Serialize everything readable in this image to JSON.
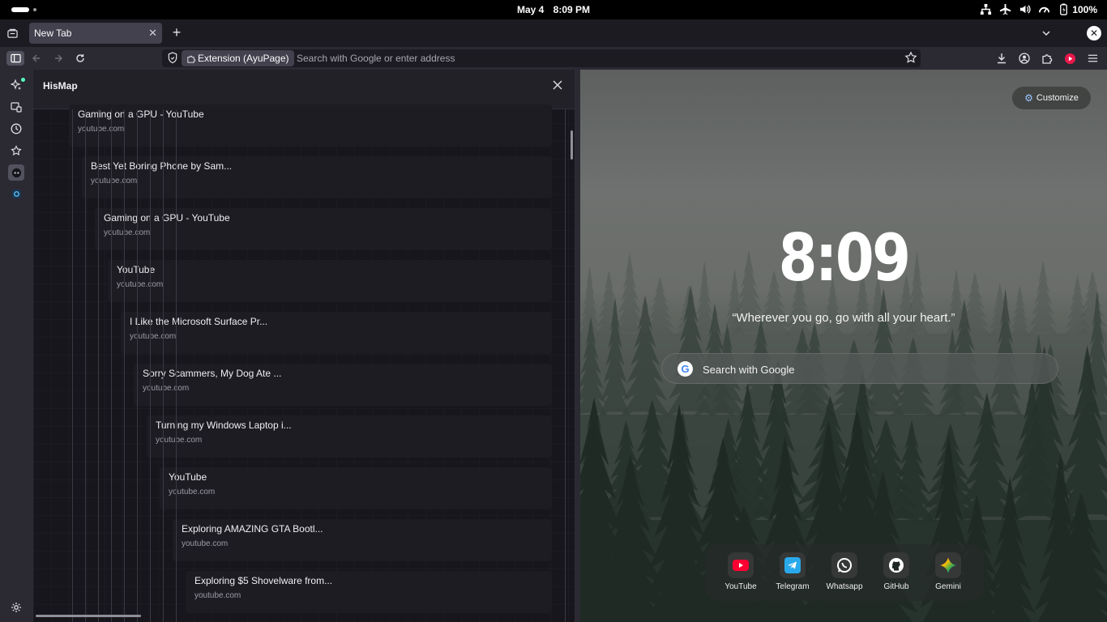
{
  "system_bar": {
    "date": "May 4",
    "time": "8:09 PM",
    "battery": "100%",
    "tray_icons": [
      "network-icon",
      "airplane-icon",
      "volume-icon",
      "performance-icon",
      "battery-icon"
    ]
  },
  "browser": {
    "tabs": [
      {
        "title": "New Tab",
        "active": true
      }
    ],
    "urlbar": {
      "extension_chip": "Extension (AyuPage)",
      "placeholder": "Search with Google or enter address"
    },
    "accent_color": "#2b2a33"
  },
  "sidebar_panel": {
    "title": "HisMap",
    "nodes": [
      {
        "title": "Gaming on a GPU - YouTube",
        "domain": "youtube.com"
      },
      {
        "title": "Best Yet Boring Phone by Sam...",
        "domain": "youtube.com"
      },
      {
        "title": "Gaming on a GPU - YouTube",
        "domain": "youtube.com"
      },
      {
        "title": "YouTube",
        "domain": "youtube.com"
      },
      {
        "title": "I Like the Microsoft Surface Pr...",
        "domain": "youtube.com"
      },
      {
        "title": "Sorry Scammers, My Dog Ate ...",
        "domain": "youtube.com"
      },
      {
        "title": "Turning my Windows Laptop i...",
        "domain": "youtube.com"
      },
      {
        "title": "YouTube",
        "domain": "youtube.com"
      },
      {
        "title": "Exploring AMAZING GTA Bootl...",
        "domain": "youtube.com"
      },
      {
        "title": "Exploring $5 Shovelware from...",
        "domain": "youtube.com"
      }
    ]
  },
  "new_tab_page": {
    "customize_label": "Customize",
    "clock": "8:09",
    "quote": "“Wherever you go, go with all your heart.”",
    "search_placeholder": "Search with Google",
    "shortcuts": [
      {
        "label": "YouTube",
        "icon": "youtube-icon",
        "color": "#ff0033"
      },
      {
        "label": "Telegram",
        "icon": "telegram-icon",
        "color": "#29a9eb"
      },
      {
        "label": "Whatsapp",
        "icon": "whatsapp-icon",
        "color": "#ffffff"
      },
      {
        "label": "GitHub",
        "icon": "github-icon",
        "color": "#ffffff"
      },
      {
        "label": "Gemini",
        "icon": "gemini-icon",
        "color": "#4f8cff"
      }
    ]
  }
}
